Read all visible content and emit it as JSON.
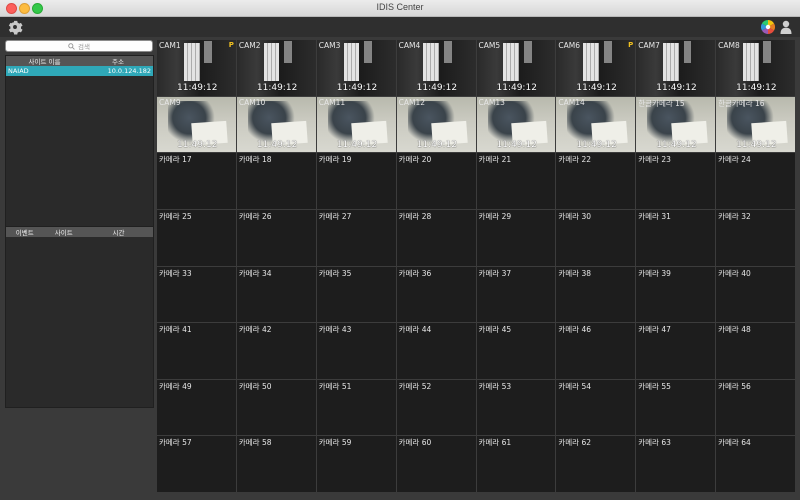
{
  "window": {
    "title": "IDIS Center"
  },
  "toolbar": {
    "settings_icon": "gear-icon",
    "color_icon": "color-wheel-icon",
    "user_icon": "user-icon"
  },
  "sidebar": {
    "search_placeholder": "검색",
    "site_table": {
      "columns": [
        "사이트 이름",
        "주소"
      ],
      "rows": [
        {
          "name": "NAIAD",
          "address": "10.0.124.182"
        }
      ]
    },
    "event_table": {
      "columns": [
        "이벤트",
        "사이트",
        "시간"
      ]
    }
  },
  "cameras": [
    {
      "label": "CAM1",
      "timestamp": "11:49:12",
      "ptz": "P",
      "feed": "dark",
      "selected": true
    },
    {
      "label": "CAM2",
      "timestamp": "11:49:12",
      "feed": "dark"
    },
    {
      "label": "CAM3",
      "timestamp": "11:49:12",
      "feed": "dark"
    },
    {
      "label": "CAM4",
      "timestamp": "11:49:12",
      "feed": "dark"
    },
    {
      "label": "CAM5",
      "timestamp": "11:49:12",
      "feed": "dark"
    },
    {
      "label": "CAM6",
      "timestamp": "11:49:12",
      "ptz": "P",
      "feed": "dark"
    },
    {
      "label": "CAM7",
      "timestamp": "11:49:12",
      "feed": "dark"
    },
    {
      "label": "CAM8",
      "timestamp": "11:49:12",
      "feed": "dark"
    },
    {
      "label": "CAM9",
      "timestamp": "11:49:12",
      "feed": "light"
    },
    {
      "label": "CAM10",
      "timestamp": "11:49:12",
      "feed": "light"
    },
    {
      "label": "CAM11",
      "timestamp": "11:49:12",
      "feed": "light"
    },
    {
      "label": "CAM12",
      "timestamp": "11:49:12",
      "feed": "light"
    },
    {
      "label": "CAM13",
      "timestamp": "11:49:12",
      "feed": "light"
    },
    {
      "label": "CAM14",
      "timestamp": "11:49:12",
      "feed": "light"
    },
    {
      "label": "한글카메라 15",
      "timestamp": "11:49:12",
      "feed": "light"
    },
    {
      "label": "한글카메라 16",
      "timestamp": "11:49:12",
      "feed": "light"
    },
    {
      "label": "카메라 17"
    },
    {
      "label": "카메라 18"
    },
    {
      "label": "카메라 19"
    },
    {
      "label": "카메라 20"
    },
    {
      "label": "카메라 21"
    },
    {
      "label": "카메라 22"
    },
    {
      "label": "카메라 23"
    },
    {
      "label": "카메라 24"
    },
    {
      "label": "카메라 25"
    },
    {
      "label": "카메라 26"
    },
    {
      "label": "카메라 27"
    },
    {
      "label": "카메라 28"
    },
    {
      "label": "카메라 29"
    },
    {
      "label": "카메라 30"
    },
    {
      "label": "카메라 31"
    },
    {
      "label": "카메라 32"
    },
    {
      "label": "카메라 33"
    },
    {
      "label": "카메라 34"
    },
    {
      "label": "카메라 35"
    },
    {
      "label": "카메라 36"
    },
    {
      "label": "카메라 37"
    },
    {
      "label": "카메라 38"
    },
    {
      "label": "카메라 39"
    },
    {
      "label": "카메라 40"
    },
    {
      "label": "카메라 41"
    },
    {
      "label": "카메라 42"
    },
    {
      "label": "카메라 43"
    },
    {
      "label": "카메라 44"
    },
    {
      "label": "카메라 45"
    },
    {
      "label": "카메라 46"
    },
    {
      "label": "카메라 47"
    },
    {
      "label": "카메라 48"
    },
    {
      "label": "카메라 49"
    },
    {
      "label": "카메라 50"
    },
    {
      "label": "카메라 51"
    },
    {
      "label": "카메라 52"
    },
    {
      "label": "카메라 53"
    },
    {
      "label": "카메라 54"
    },
    {
      "label": "카메라 55"
    },
    {
      "label": "카메라 56"
    },
    {
      "label": "카메라 57"
    },
    {
      "label": "카메라 58"
    },
    {
      "label": "카메라 59"
    },
    {
      "label": "카메라 60"
    },
    {
      "label": "카메라 61"
    },
    {
      "label": "카메라 62"
    },
    {
      "label": "카메라 63"
    },
    {
      "label": "카메라 64"
    }
  ]
}
